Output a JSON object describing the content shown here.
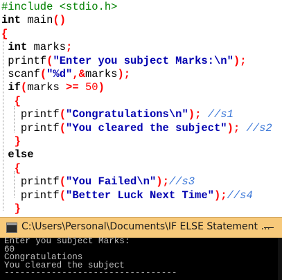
{
  "editor": {
    "lines": [
      [
        {
          "t": "pre",
          "v": "#include <stdio.h>"
        }
      ],
      [
        {
          "t": "kw",
          "v": "int"
        },
        {
          "t": "fn",
          "v": " main"
        },
        {
          "t": "op",
          "v": "()"
        }
      ],
      [
        {
          "t": "op",
          "v": "{"
        }
      ],
      [
        {
          "t": "fn",
          "v": " "
        },
        {
          "t": "kw",
          "v": "int"
        },
        {
          "t": "fn",
          "v": " marks"
        },
        {
          "t": "op",
          "v": ";"
        }
      ],
      [
        {
          "t": "fn",
          "v": " printf"
        },
        {
          "t": "op",
          "v": "("
        },
        {
          "t": "str",
          "v": "\"Enter you subject Marks:\\n\""
        },
        {
          "t": "op",
          "v": ");"
        }
      ],
      [
        {
          "t": "fn",
          "v": " scanf"
        },
        {
          "t": "op",
          "v": "("
        },
        {
          "t": "str",
          "v": "\"%d\""
        },
        {
          "t": "op",
          "v": ",&"
        },
        {
          "t": "fn",
          "v": "marks"
        },
        {
          "t": "op",
          "v": ");"
        }
      ],
      [
        {
          "t": "fn",
          "v": " "
        },
        {
          "t": "kw",
          "v": "if"
        },
        {
          "t": "op",
          "v": "("
        },
        {
          "t": "fn",
          "v": "marks "
        },
        {
          "t": "op",
          "v": ">="
        },
        {
          "t": "fn",
          "v": " "
        },
        {
          "t": "num",
          "v": "50"
        },
        {
          "t": "op",
          "v": ")"
        }
      ],
      [
        {
          "t": "fn",
          "v": "  "
        },
        {
          "t": "op",
          "v": "{"
        }
      ],
      [
        {
          "t": "fn",
          "v": "   printf"
        },
        {
          "t": "op",
          "v": "("
        },
        {
          "t": "str",
          "v": "\"Congratulations\\n\""
        },
        {
          "t": "op",
          "v": ");"
        },
        {
          "t": "fn",
          "v": " "
        },
        {
          "t": "com",
          "v": "//s1"
        }
      ],
      [
        {
          "t": "fn",
          "v": "   printf"
        },
        {
          "t": "op",
          "v": "("
        },
        {
          "t": "str",
          "v": "\"You cleared the subject\""
        },
        {
          "t": "op",
          "v": ");"
        },
        {
          "t": "fn",
          "v": " "
        },
        {
          "t": "com",
          "v": "//s2"
        }
      ],
      [
        {
          "t": "fn",
          "v": "  "
        },
        {
          "t": "op",
          "v": "}"
        }
      ],
      [
        {
          "t": "fn",
          "v": " "
        },
        {
          "t": "kw",
          "v": "else"
        }
      ],
      [
        {
          "t": "fn",
          "v": "  "
        },
        {
          "t": "op",
          "v": "{"
        }
      ],
      [
        {
          "t": "fn",
          "v": "   printf"
        },
        {
          "t": "op",
          "v": "("
        },
        {
          "t": "str",
          "v": "\"You Failed\\n\""
        },
        {
          "t": "op",
          "v": ");"
        },
        {
          "t": "com",
          "v": "//s3"
        }
      ],
      [
        {
          "t": "fn",
          "v": "   printf"
        },
        {
          "t": "op",
          "v": "("
        },
        {
          "t": "str",
          "v": "\"Better Luck Next Time\""
        },
        {
          "t": "op",
          "v": ");"
        },
        {
          "t": "com",
          "v": "//s4"
        }
      ],
      [
        {
          "t": "fn",
          "v": "  "
        },
        {
          "t": "op",
          "v": "}"
        }
      ]
    ]
  },
  "console": {
    "title": "C:\\Users\\Personal\\Documents\\IF ELSE Statement ...",
    "output": [
      "Enter you subject Marks:",
      "60",
      "Congratulations",
      "You cleared the subject",
      "---------------------------------"
    ]
  },
  "colors": {
    "preprocessor": "#008000",
    "operator": "#ff0000",
    "string": "#0000b0",
    "comment": "#3c78d8",
    "titlebar": "#f7c97a",
    "console_bg": "#000000",
    "console_text": "#c0c0c0"
  },
  "icons": {
    "app": "console-app-icon",
    "minimize": "minimize-icon"
  }
}
